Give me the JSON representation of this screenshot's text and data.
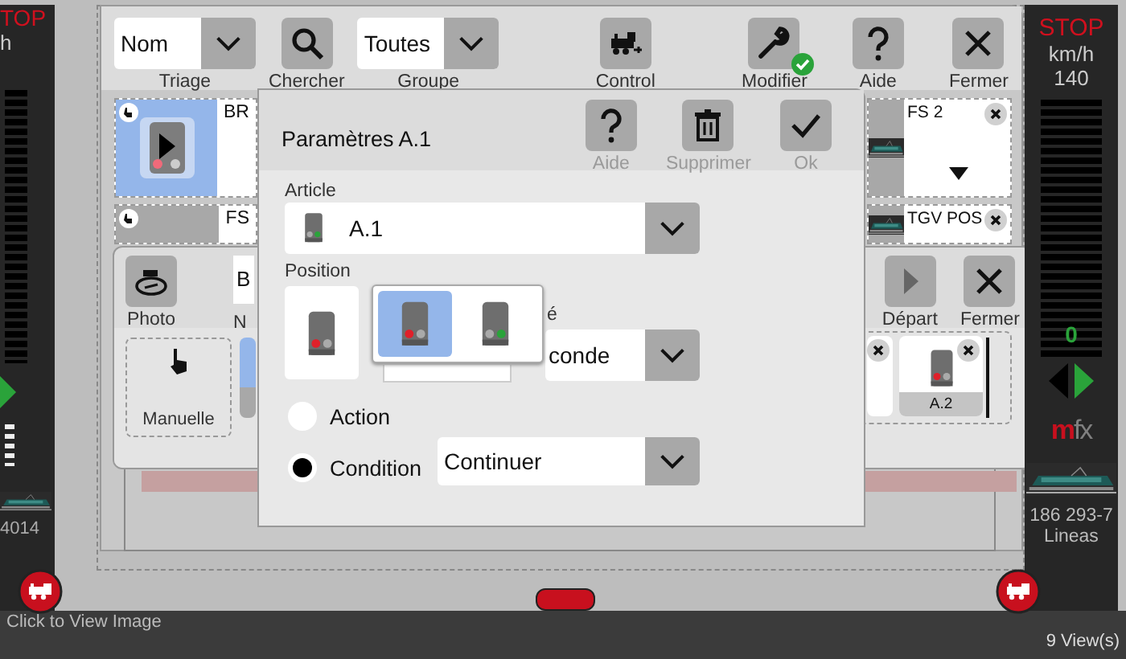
{
  "left_panel": {
    "stop": "TOP",
    "unit": "h",
    "loco_name": "4014"
  },
  "right_panel": {
    "stop": "STOP",
    "unit": "km/h",
    "max_speed": "140",
    "speed": "0",
    "logo": {
      "m": "m",
      "fx": "fx"
    },
    "loco_name": "186 293-7 Lineas"
  },
  "main_window": {
    "toolbar": [
      {
        "kind": "dropdown",
        "value": "Nom",
        "label": "Triage"
      },
      {
        "kind": "button",
        "label": "Chercher"
      },
      {
        "kind": "dropdown",
        "value": "Toutes",
        "label": "Groupe"
      },
      {
        "kind": "button",
        "label": "Control"
      },
      {
        "kind": "button",
        "label": "Modifier",
        "active": true
      },
      {
        "kind": "button",
        "label": "Aide"
      },
      {
        "kind": "button",
        "label": "Fermer"
      }
    ],
    "cards_left": [
      {
        "title": "BR",
        "selected": true
      },
      {
        "title": "FS",
        "selected": false
      }
    ],
    "cards_right": [
      {
        "title": "FS 2"
      },
      {
        "title": "TGV POS"
      }
    ]
  },
  "second_window": {
    "photo_button": "Photo",
    "name_value": "B",
    "name_label": "N",
    "buttons": [
      {
        "label": "Départ"
      },
      {
        "label": "Fermer"
      }
    ],
    "manual_card": "Manuelle",
    "items": [
      {
        "title": "A.2",
        "kind": "stop"
      }
    ]
  },
  "dialog": {
    "title": "Paramètres A.1",
    "buttons": [
      {
        "label": "Aide"
      },
      {
        "label": "Supprimer"
      },
      {
        "label": "Ok"
      }
    ],
    "article": {
      "label": "Article",
      "value": "A.1",
      "kind": "go"
    },
    "position": {
      "label": "Position",
      "kind": "stop",
      "options": [
        {
          "kind": "stop",
          "selected": true
        },
        {
          "kind": "go",
          "selected": false
        }
      ]
    },
    "hidden_label": "é",
    "delay": {
      "value": "conde"
    },
    "modes": [
      {
        "label": "Action",
        "selected": false
      },
      {
        "label": "Condition",
        "selected": true
      }
    ],
    "condition": {
      "value": "Continuer"
    }
  },
  "status_bar": {
    "left": "Click to View Image",
    "right": "9 View(s)"
  }
}
